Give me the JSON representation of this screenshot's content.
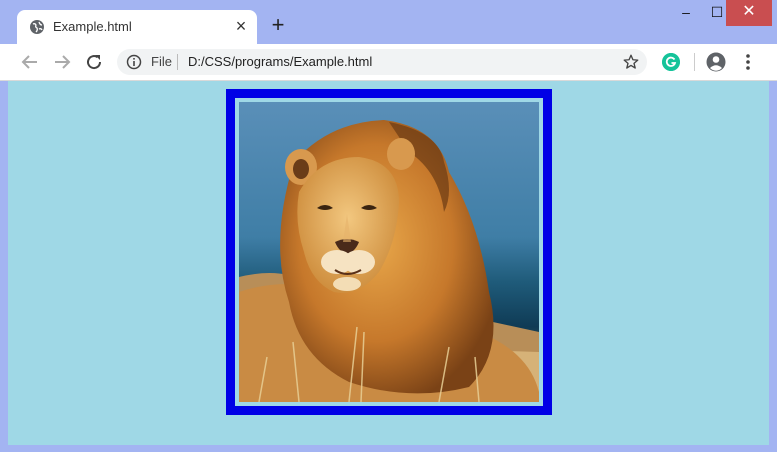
{
  "tab": {
    "title": "Example.html"
  },
  "window_controls": {
    "minimize": "‒",
    "maximize": "☐",
    "close": "✕"
  },
  "omnibox": {
    "scheme_label": "File",
    "url": "D:/CSS/programs/Example.html"
  },
  "image": {
    "subject": "lion photo"
  },
  "colors": {
    "page_background": "#9fd8e6",
    "image_border": "#0000e6"
  }
}
